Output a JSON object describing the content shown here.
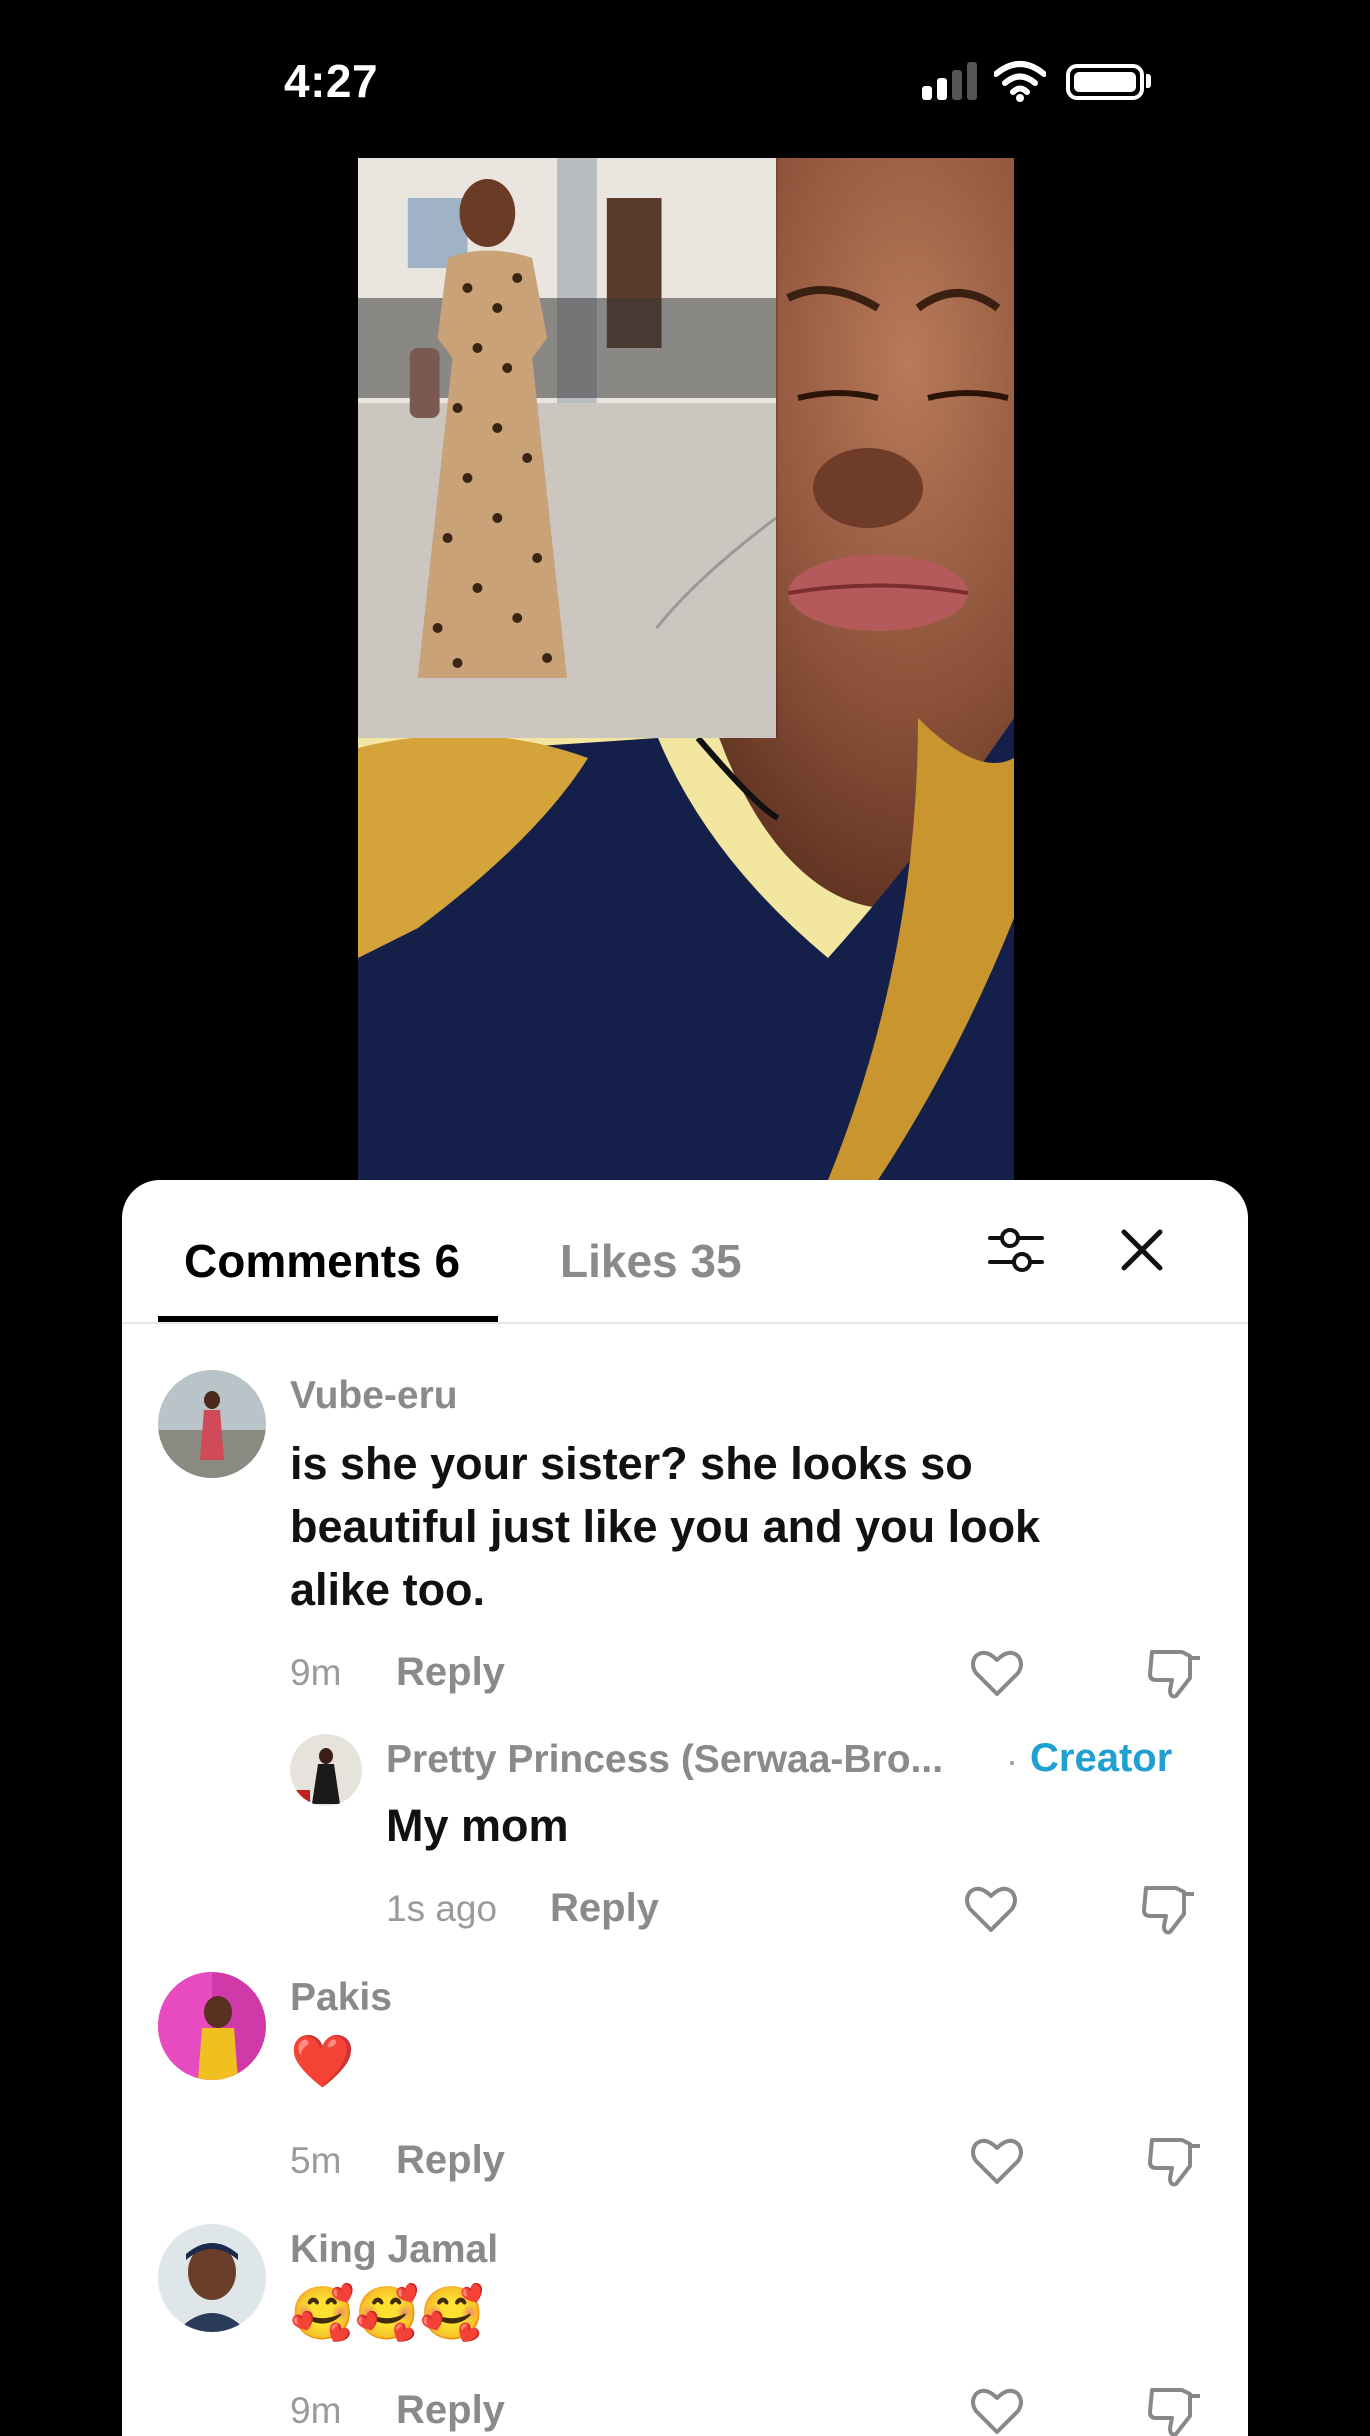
{
  "status_bar": {
    "time": "4:27"
  },
  "sheet": {
    "tabs": {
      "comments": "Comments 6",
      "likes": "Likes 35"
    }
  },
  "comments": [
    {
      "username": "Vube-eru",
      "text": "is she your sister? she looks so beautiful just like you and you look alike too.",
      "time": "9m",
      "reply_label": "Reply"
    },
    {
      "username": "Pretty Princess (Serwaa-Bro...",
      "badge_separator": "·",
      "badge": "Creator",
      "text": "My mom",
      "time": "1s ago",
      "reply_label": "Reply"
    },
    {
      "username": "Pakis",
      "text": "❤️",
      "time": "5m",
      "reply_label": "Reply"
    },
    {
      "username": "King Jamal",
      "text": "🥰🥰🥰",
      "time": "9m",
      "reply_label": "Reply"
    }
  ],
  "icons": {
    "like": "heart-outline-icon",
    "dislike": "thumbs-down-icon",
    "filter": "sliders-icon",
    "close": "close-icon"
  },
  "colors": {
    "creator_badge": "#20a0d0",
    "username": "#8a8a8a"
  }
}
